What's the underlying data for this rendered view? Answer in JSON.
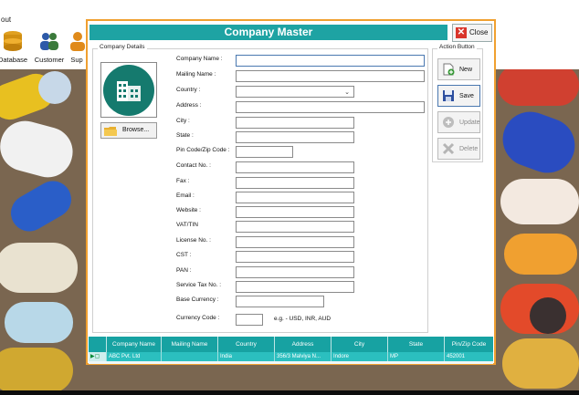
{
  "app": {
    "menu_fragment": "out",
    "toolbar": [
      {
        "label": "Database",
        "icon": "database-icon"
      },
      {
        "label": "Customer",
        "icon": "customer-icon"
      },
      {
        "label": "Sup",
        "icon": "supplier-icon"
      }
    ]
  },
  "dialog": {
    "title": "Company Master",
    "close_label": "Close",
    "company_details_title": "Company Details",
    "browse_label": "Browse...",
    "fields": {
      "company_name": {
        "label": "Company Name :",
        "value": ""
      },
      "mailing_name": {
        "label": "Mailing Name :",
        "value": ""
      },
      "country": {
        "label": "Country :",
        "value": ""
      },
      "address": {
        "label": "Address :",
        "value": ""
      },
      "city": {
        "label": "City :",
        "value": ""
      },
      "state": {
        "label": "State :",
        "value": ""
      },
      "pin_code": {
        "label": "Pin Code/Zip Code :",
        "value": ""
      },
      "contact_no": {
        "label": "Contact No. :",
        "value": ""
      },
      "fax": {
        "label": "Fax :",
        "value": ""
      },
      "email": {
        "label": "Email :",
        "value": ""
      },
      "website": {
        "label": "Website :",
        "value": ""
      },
      "vat_tin": {
        "label": "VAT/TIN",
        "value": ""
      },
      "license_no": {
        "label": "License No. :",
        "value": ""
      },
      "cst": {
        "label": "CST :",
        "value": ""
      },
      "pan": {
        "label": "PAN :",
        "value": ""
      },
      "service_tax_no": {
        "label": "Service Tax No. :",
        "value": ""
      },
      "base_currency": {
        "label": "Base Currency :",
        "value": ""
      },
      "currency_code": {
        "label": "Currency Code :",
        "value": "",
        "hint": "e.g. - USD, INR, AUD"
      }
    },
    "action_group_title": "Action Button",
    "actions": {
      "new": "New",
      "save": "Save",
      "update": "Update",
      "delete": "Delete"
    },
    "colors": {
      "title_bar": "#1ea3a3",
      "dialog_border": "#f0a030",
      "grid_header": "#17a2a2",
      "grid_row": "#2bbfbf"
    },
    "grid": {
      "columns": [
        "Company Name",
        "Mailing Name",
        "Country",
        "Address",
        "City",
        "State",
        "Pin/Zip Code"
      ],
      "rows": [
        [
          "ABC Pvt. Ltd",
          "",
          "India",
          "356/3 Malviya N...",
          "Indore",
          "MP",
          "452001"
        ]
      ]
    }
  }
}
